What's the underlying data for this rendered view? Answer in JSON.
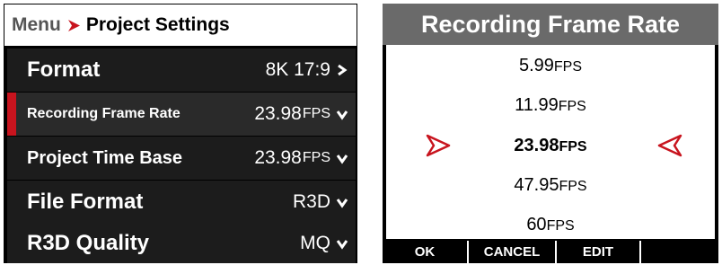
{
  "menu": {
    "breadcrumb": {
      "root": "Menu",
      "current": "Project Settings"
    },
    "items": [
      {
        "label": "Format",
        "value": "8K 17:9",
        "unit": "",
        "indicator": "chevron-right-icon"
      },
      {
        "label": "Recording Frame Rate",
        "value": "23.98",
        "unit": "FPS",
        "indicator": "chevron-down-icon",
        "selected": true
      },
      {
        "label": "Project Time Base",
        "value": "23.98",
        "unit": "FPS",
        "indicator": "chevron-down-icon"
      },
      {
        "label": "File Format",
        "value": "R3D",
        "unit": "",
        "indicator": "chevron-down-icon"
      },
      {
        "label": "R3D Quality",
        "value": "MQ",
        "unit": "",
        "indicator": "chevron-down-icon"
      }
    ]
  },
  "picker": {
    "title": "Recording Frame Rate",
    "options": [
      {
        "value": "5.99",
        "unit": "FPS"
      },
      {
        "value": "11.99",
        "unit": "FPS"
      },
      {
        "value": "23.98",
        "unit": "FPS",
        "selected": true
      },
      {
        "value": "47.95",
        "unit": "FPS"
      },
      {
        "value": "60",
        "unit": "FPS"
      }
    ]
  },
  "softkeys": {
    "ok": "OK",
    "cancel": "CANCEL",
    "edit": "EDIT"
  },
  "colors": {
    "accent": "#c8141e",
    "header_gray": "#6a6a6a",
    "panel_bg": "#000000"
  }
}
